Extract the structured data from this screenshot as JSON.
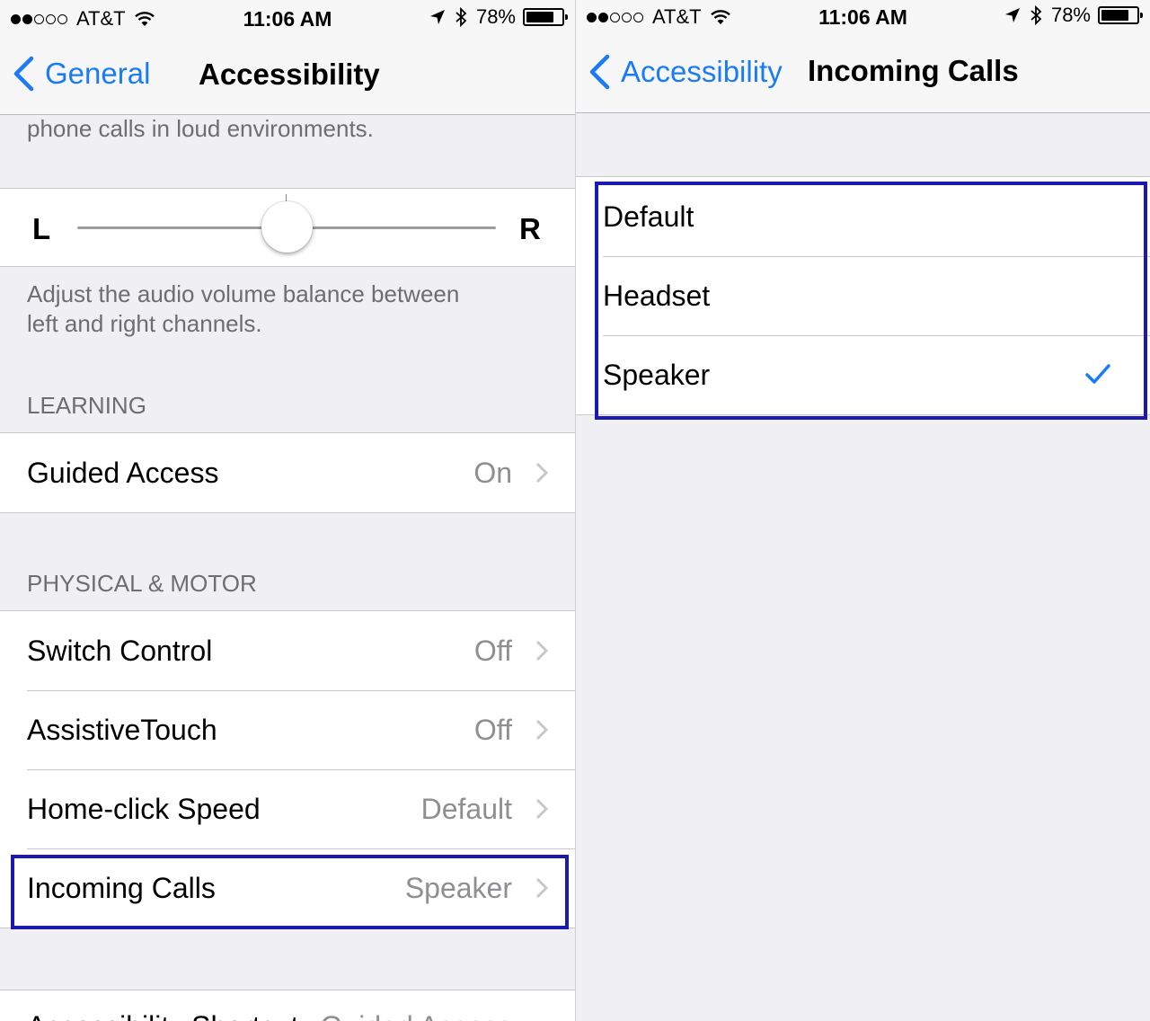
{
  "status": {
    "signal_dots_filled": 2,
    "signal_dots_total": 5,
    "carrier": "AT&T",
    "time": "11:06 AM",
    "battery": "78%",
    "battery_level": 0.78,
    "icons": [
      "wifi-icon",
      "location-arrow-icon",
      "bluetooth-icon",
      "battery-icon"
    ]
  },
  "left": {
    "nav": {
      "back_label": "General",
      "title": "Accessibility"
    },
    "top_desc": "phone calls in loud environments.",
    "balance": {
      "left_label": "L",
      "right_label": "R",
      "value": 0.5
    },
    "balance_desc_line1": "Adjust the audio volume balance between",
    "balance_desc_line2": "left and right channels.",
    "learning": {
      "header": "LEARNING",
      "rows": [
        {
          "label": "Guided Access",
          "value": "On"
        }
      ]
    },
    "physical": {
      "header": "PHYSICAL & MOTOR",
      "rows": [
        {
          "label": "Switch Control",
          "value": "Off"
        },
        {
          "label": "AssistiveTouch",
          "value": "Off"
        },
        {
          "label": "Home-click Speed",
          "value": "Default"
        },
        {
          "label": "Incoming Calls",
          "value": "Speaker"
        }
      ]
    },
    "shortcut": {
      "label": "Accessibility Shortcut",
      "value": "Guided Access"
    }
  },
  "right": {
    "nav": {
      "back_label": "Accessibility",
      "title": "Incoming Calls"
    },
    "options": [
      "Default",
      "Headset",
      "Speaker"
    ],
    "selected": "Speaker"
  },
  "colors": {
    "accent": "#1a7bf7",
    "highlight": "#1a1ab3",
    "background": "#efeff4",
    "secondary_text": "#8e8e93"
  }
}
